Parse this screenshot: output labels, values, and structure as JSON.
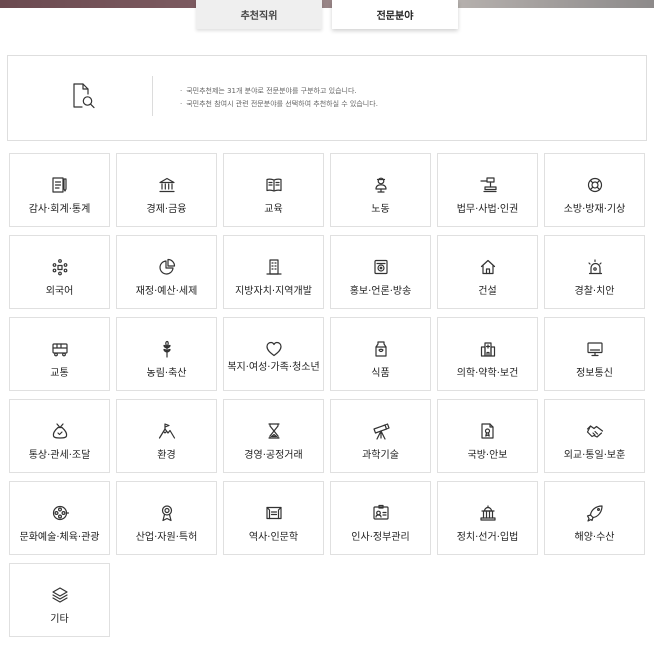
{
  "tabs": {
    "recommended_position": "추천직위",
    "expert_field": "전문분야"
  },
  "info": {
    "icon": "document-search-icon",
    "notes": [
      "국민추천제는 31개 분야로 전문분야를 구분하고 있습니다.",
      "국민추천 참여시 관련 전문분야를 선택하여 추천하실 수 있습니다."
    ]
  },
  "fields": [
    {
      "label": "감사·회계·통계",
      "icon": "ledger-pen-icon"
    },
    {
      "label": "경제·금융",
      "icon": "bank-icon"
    },
    {
      "label": "교육",
      "icon": "book-icon"
    },
    {
      "label": "노동",
      "icon": "worker-icon"
    },
    {
      "label": "법무·사법·인권",
      "icon": "gavel-icon"
    },
    {
      "label": "소방·방재·기상",
      "icon": "lifebuoy-icon"
    },
    {
      "label": "외국어",
      "icon": "language-dots-icon"
    },
    {
      "label": "재정·예산·세제",
      "icon": "pie-chart-icon"
    },
    {
      "label": "지방자치·지역개발",
      "icon": "building-icon"
    },
    {
      "label": "홍보·언론·방송",
      "icon": "radio-icon"
    },
    {
      "label": "건설",
      "icon": "house-icon"
    },
    {
      "label": "경찰·치안",
      "icon": "siren-icon"
    },
    {
      "label": "교통",
      "icon": "bus-icon"
    },
    {
      "label": "농림·축산",
      "icon": "wheat-icon"
    },
    {
      "label": "복지·여성·가족·청소년",
      "icon": "heart-icon"
    },
    {
      "label": "식품",
      "icon": "milk-carton-icon"
    },
    {
      "label": "의학·약학·보건",
      "icon": "hospital-icon"
    },
    {
      "label": "정보통신",
      "icon": "monitor-icon"
    },
    {
      "label": "통상·관세·조달",
      "icon": "money-bag-icon"
    },
    {
      "label": "환경",
      "icon": "mountain-flag-icon"
    },
    {
      "label": "경영·공정거래",
      "icon": "hourglass-icon"
    },
    {
      "label": "과학기술",
      "icon": "telescope-icon"
    },
    {
      "label": "국방·안보",
      "icon": "document-medal-icon"
    },
    {
      "label": "외교·통일·보훈",
      "icon": "handshake-icon"
    },
    {
      "label": "문화예술·체육·관광",
      "icon": "film-reel-icon"
    },
    {
      "label": "산업·자원·특허",
      "icon": "award-ribbon-icon"
    },
    {
      "label": "역사·인문학",
      "icon": "scroll-map-icon"
    },
    {
      "label": "인사·정부관리",
      "icon": "id-card-icon"
    },
    {
      "label": "정치·선거·입법",
      "icon": "parliament-icon"
    },
    {
      "label": "해양·수산",
      "icon": "fish-icon"
    },
    {
      "label": "기타",
      "icon": "layers-icon"
    }
  ]
}
